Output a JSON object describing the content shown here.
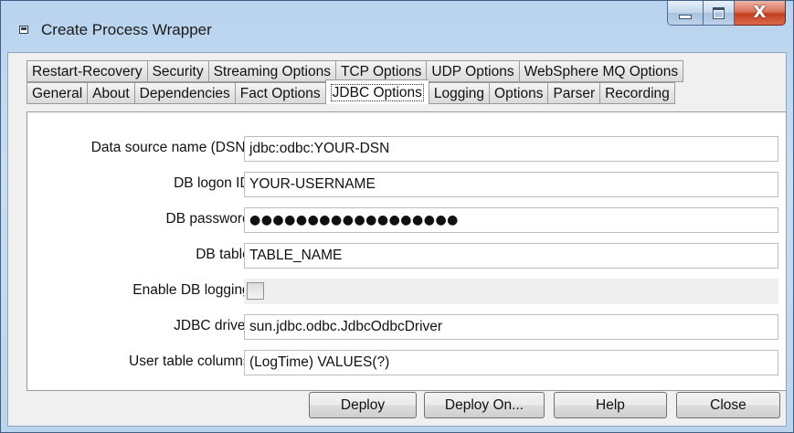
{
  "window": {
    "title": "Create Process Wrapper",
    "close_glyph": "X"
  },
  "tabs": {
    "row1": [
      "Restart-Recovery",
      "Security",
      "Streaming Options",
      "TCP Options",
      "UDP Options",
      "WebSphere MQ Options"
    ],
    "row2": [
      "General",
      "About",
      "Dependencies",
      "Fact Options",
      "JDBC Options",
      "Logging",
      "Options",
      "Parser",
      "Recording"
    ],
    "active": "JDBC Options"
  },
  "form": {
    "dsn_label": "Data source name (DSN):",
    "dsn_value": "jdbc:odbc:YOUR-DSN",
    "logon_label": "DB logon ID:",
    "logon_value": "YOUR-USERNAME",
    "password_label": "DB password:",
    "password_value": "●●●●●●●●●●●●●●●●●●",
    "table_label": "DB table:",
    "table_value": "TABLE_NAME",
    "logging_label": "Enable DB logging:",
    "logging_checked": false,
    "driver_label": "JDBC driver:",
    "driver_value": "sun.jdbc.odbc.JdbcOdbcDriver",
    "columns_label": "User table columns:",
    "columns_value": "(LogTime) VALUES(?)"
  },
  "buttons": {
    "deploy": "Deploy",
    "deploy_on": "Deploy On...",
    "help": "Help",
    "close": "Close"
  }
}
